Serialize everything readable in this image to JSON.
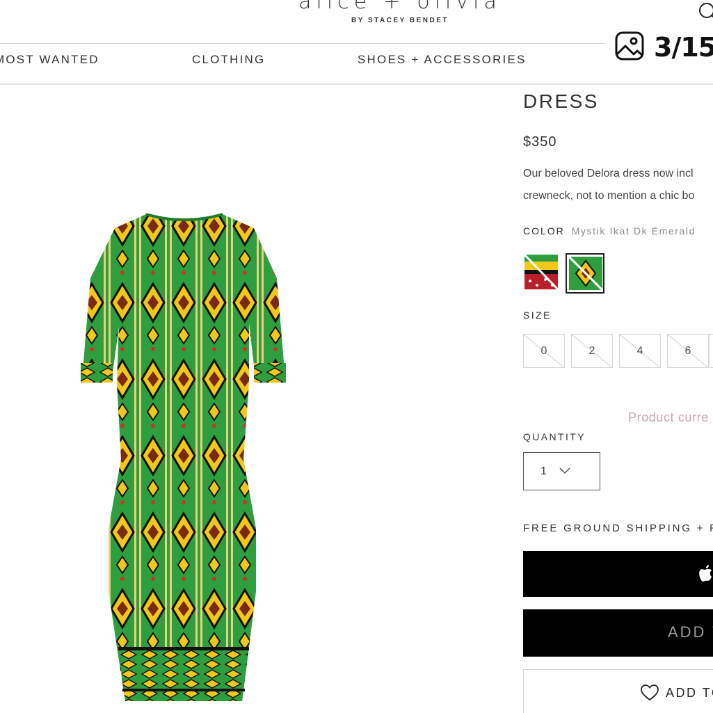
{
  "brand": {
    "name": "alice + olivia",
    "byline": "BY STACEY BENDET"
  },
  "nav": {
    "items": [
      "MOST WANTED",
      "CLOTHING",
      "SHOES + ACCESSORIES"
    ]
  },
  "gallery": {
    "counter": "3/15",
    "icon": "image-icon"
  },
  "product": {
    "title": "DRESS",
    "price": "$350",
    "description_line1": "Our beloved Delora dress now incl",
    "description_line2": "crewneck, not to mention a chic bo",
    "color_label": "COLOR",
    "color_value": "Mystik Ikat Dk Emerald",
    "size_label": "SIZE",
    "sizes": [
      "0",
      "2",
      "4",
      "6"
    ],
    "status": "Product curre",
    "quantity_label": "QUANTITY",
    "quantity_value": "1",
    "shipping": "FREE GROUND SHIPPING + RET",
    "add_to_cart": "ADD T",
    "wishlist": "ADD TO"
  },
  "colors": {
    "emerald": "#2e9e3f",
    "yellow": "#f1c71b",
    "black": "#000000",
    "status_pink": "#c6a8ac"
  }
}
